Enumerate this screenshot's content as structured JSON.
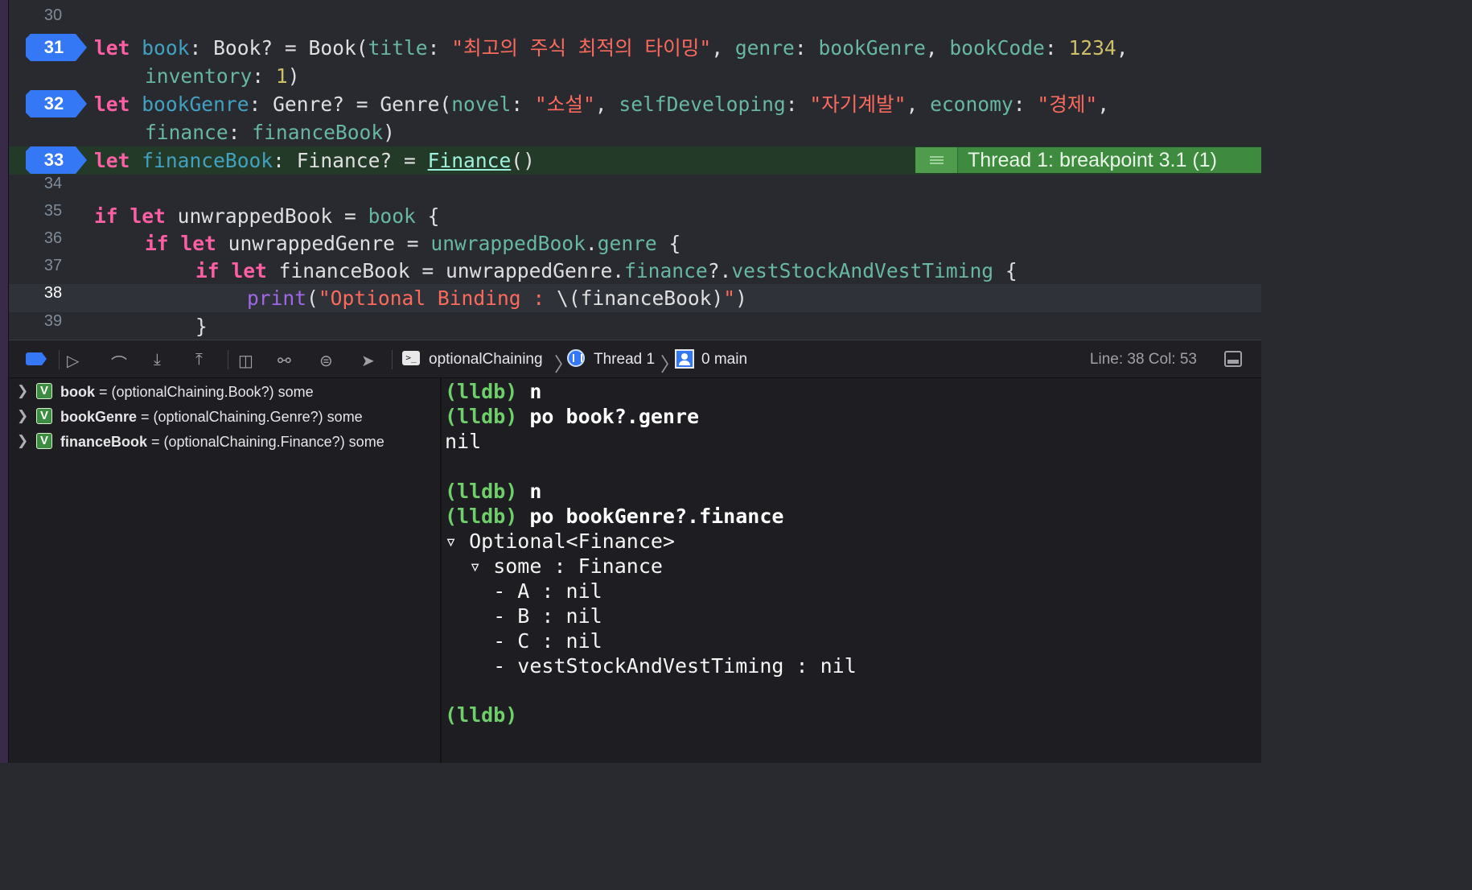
{
  "editor": {
    "line30": "30",
    "line31": "31",
    "line32": "32",
    "line33": "33",
    "line34": "34",
    "line35": "35",
    "line36": "36",
    "line37": "37",
    "line38": "38",
    "line39": "39",
    "code": {
      "l31a_kw": "let",
      "l31a_name": "book",
      "l31a_rest1": ": Book? = Book(",
      "l31a_title": "title",
      "l31a_colon": ": ",
      "l31a_str": "\"최고의 주식 최적의 타이밍\"",
      "l31a_comma": ", ",
      "l31a_genre": "genre",
      "l31a_colon2": ": ",
      "l31a_bookGenre": "bookGenre",
      "l31a_comma2": ", ",
      "l31a_bookCode": "bookCode",
      "l31a_colon3": ": ",
      "l31a_num": "1234",
      "l31a_comma3": ",",
      "l31b_inventory": "inventory",
      "l31b_colon": ": ",
      "l31b_num": "1",
      "l31b_close": ")",
      "l32a_kw": "let",
      "l32a_name": "bookGenre",
      "l32a_rest1": ": Genre? = Genre(",
      "l32a_novel": "novel",
      "l32a_c1": ": ",
      "l32a_s1": "\"소설\"",
      "l32a_cm1": ", ",
      "l32a_self": "selfDeveloping",
      "l32a_c2": ": ",
      "l32a_s2": "\"자기계발\"",
      "l32a_cm2": ", ",
      "l32a_eco": "economy",
      "l32a_c3": ": ",
      "l32a_s3": "\"경제\"",
      "l32a_cm3": ",",
      "l32b_finance": "finance",
      "l32b_c": ": ",
      "l32b_val": "financeBook",
      "l32b_close": ")",
      "l33_kw": "let",
      "l33_name": "financeBook",
      "l33_rest1": ": Finance? = ",
      "l33_call": "Finance",
      "l33_close": "()",
      "l35_if": "if",
      "l35_let": "let",
      "l35_rest": " unwrappedBook = ",
      "l35_book": "book",
      "l35_brace": " {",
      "l36_if": "if",
      "l36_let": "let",
      "l36_rest": " unwrappedGenre = ",
      "l36_ub": "unwrappedBook",
      "l36_dot": ".",
      "l36_genre": "genre",
      "l36_brace": " {",
      "l37_if": "if",
      "l37_let": "let",
      "l37_rest": " financeBook = unwrappedGenre.",
      "l37_fin": "finance",
      "l37_q": "?.",
      "l37_vest": "vestStockAndVestTiming",
      "l37_brace": " {",
      "l38_print": "print",
      "l38_open": "(",
      "l38_str": "\"Optional Binding : ",
      "l38_interp": "\\(financeBook)",
      "l38_strend": "\"",
      "l38_close": ")",
      "l39_brace": "}"
    },
    "breakpoint_banner": "Thread 1: breakpoint 3.1 (1)"
  },
  "debugbar": {
    "target": "optionalChaining",
    "thread": "Thread 1",
    "frame": "0 main",
    "line_col": "Line: 38  Col: 53"
  },
  "variables": [
    {
      "name": "book",
      "detail": " = (optionalChaining.Book?) some"
    },
    {
      "name": "bookGenre",
      "detail": " = (optionalChaining.Genre?) some"
    },
    {
      "name": "financeBook",
      "detail": " = (optionalChaining.Finance?) some"
    }
  ],
  "console": {
    "prompt": "(lldb)",
    "c1": " n",
    "c2": " po book?.genre",
    "o1": "nil",
    "c3": " n",
    "c4": " po bookGenre?.finance",
    "o2": "▿ Optional<Finance>",
    "o3": "  ▿ some : Finance",
    "o4": "    - A : nil",
    "o5": "    - B : nil",
    "o6": "    - C : nil",
    "o7": "    - vestStockAndVestTiming : nil"
  },
  "colors": {
    "breakpoint": "#3478f6",
    "keyword": "#fc5fa3",
    "string": "#fc6a5d",
    "number": "#d0bf69",
    "lldb_prompt": "#6fcf6a"
  }
}
